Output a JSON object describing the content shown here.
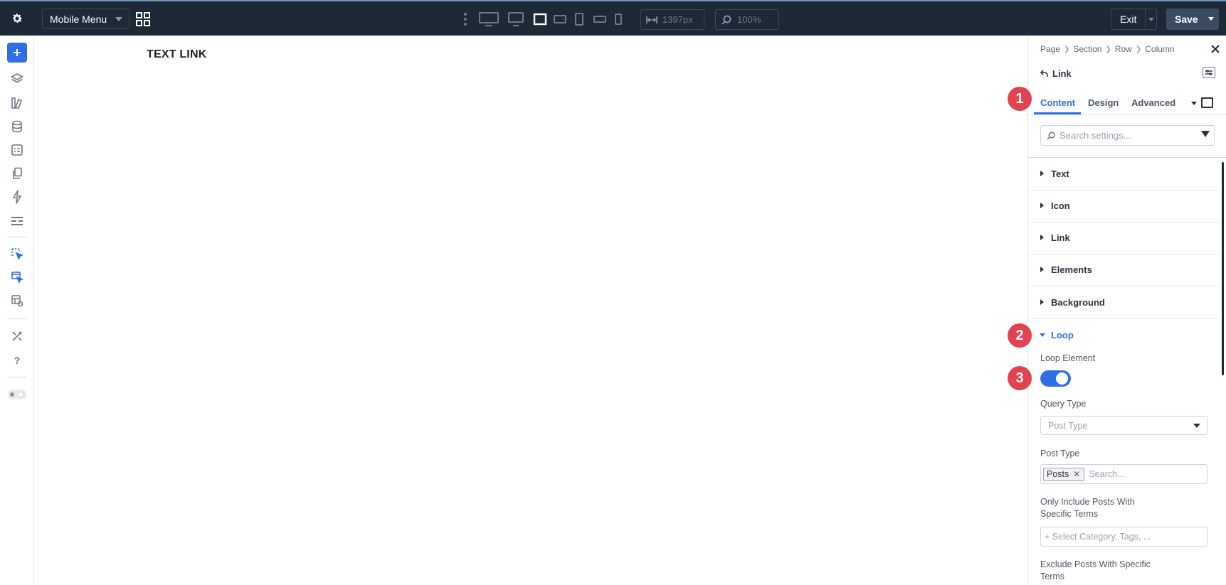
{
  "topbar": {
    "page_select": "Mobile Menu",
    "width_value": "1397px",
    "zoom_value": "100%",
    "exit_label": "Exit",
    "save_label": "Save"
  },
  "canvas": {
    "text_link": "TEXT LINK"
  },
  "panel": {
    "breadcrumb": [
      "Page",
      "Section",
      "Row",
      "Column"
    ],
    "module_title": "Link",
    "tabs": [
      "Content",
      "Design",
      "Advanced"
    ],
    "search_placeholder": "Search settings...",
    "groups": [
      "Text",
      "Icon",
      "Link",
      "Elements",
      "Background"
    ],
    "loop": {
      "title": "Loop",
      "loop_element_label": "Loop Element",
      "loop_element_on": true,
      "query_type_label": "Query Type",
      "query_type_value": "Post Type",
      "post_type_label": "Post Type",
      "post_type_tag": "Posts",
      "post_type_search": "Search...",
      "include_terms_label_1": "Only Include Posts With",
      "include_terms_label_2": "Specific Terms",
      "include_terms_placeholder": "+ Select Category, Tags, ...",
      "exclude_terms_label_1": "Exclude Posts With Specific",
      "exclude_terms_label_2": "Terms"
    }
  },
  "badges": [
    "1",
    "2",
    "3"
  ],
  "colors": {
    "topbar_bg": "#1e2938",
    "accent": "#2f6fe6",
    "badge": "#e2434f"
  }
}
